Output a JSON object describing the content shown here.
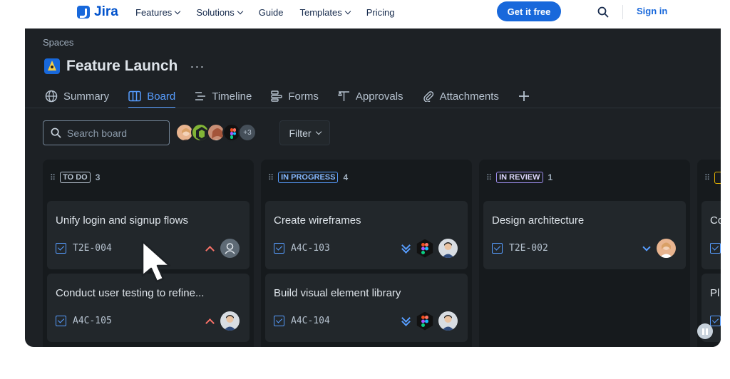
{
  "nav": {
    "brand": "Jira",
    "links": [
      {
        "label": "Features",
        "dropdown": true
      },
      {
        "label": "Solutions",
        "dropdown": true
      },
      {
        "label": "Guide",
        "dropdown": false
      },
      {
        "label": "Templates",
        "dropdown": true
      },
      {
        "label": "Pricing",
        "dropdown": false
      }
    ],
    "cta": "Get it free",
    "signin": "Sign in"
  },
  "app": {
    "breadcrumb": "Spaces",
    "project_title": "Feature Launch",
    "more": "···",
    "tabs": [
      {
        "label": "Summary",
        "icon": "globe-icon",
        "active": false
      },
      {
        "label": "Board",
        "icon": "board-icon",
        "active": true
      },
      {
        "label": "Timeline",
        "icon": "timeline-icon",
        "active": false
      },
      {
        "label": "Forms",
        "icon": "forms-icon",
        "active": false
      },
      {
        "label": "Approvals",
        "icon": "approvals-icon",
        "active": false
      },
      {
        "label": "Attachments",
        "icon": "paperclip-icon",
        "active": false
      }
    ],
    "search_placeholder": "Search board",
    "more_avatars": "+3",
    "filter_label": "Filter",
    "columns": [
      {
        "status": "TO DO",
        "count": "3",
        "color": "#b6c2cf",
        "cards": [
          {
            "title": "Unify login and signup flows",
            "key": "T2E-004",
            "priority": "high"
          },
          {
            "title": "Conduct user testing to refine...",
            "key": "A4C-105",
            "priority": "high"
          }
        ]
      },
      {
        "status": "IN PROGRESS",
        "count": "4",
        "color": "#85b8ff",
        "cards": [
          {
            "title": "Create wireframes",
            "key": "A4C-103",
            "priority": "low"
          },
          {
            "title": "Build visual element library",
            "key": "A4C-104",
            "priority": "low"
          }
        ]
      },
      {
        "status": "IN REVIEW",
        "count": "1",
        "color": "#dfd8fd",
        "cards": [
          {
            "title": "Design architecture",
            "key": "T2E-002",
            "priority": "minor"
          }
        ]
      },
      {
        "status": "",
        "count": "",
        "color": "#e2b203",
        "cards": [
          {
            "title": "Co",
            "key": "",
            "priority": ""
          },
          {
            "title": "Pl",
            "key": "",
            "priority": ""
          }
        ]
      }
    ]
  },
  "colors": {
    "accent": "#1868db",
    "panel": "#1d2125",
    "column": "#161a1d",
    "card": "#22272b",
    "priority_high": "#f87168",
    "priority_low": "#579dff"
  }
}
